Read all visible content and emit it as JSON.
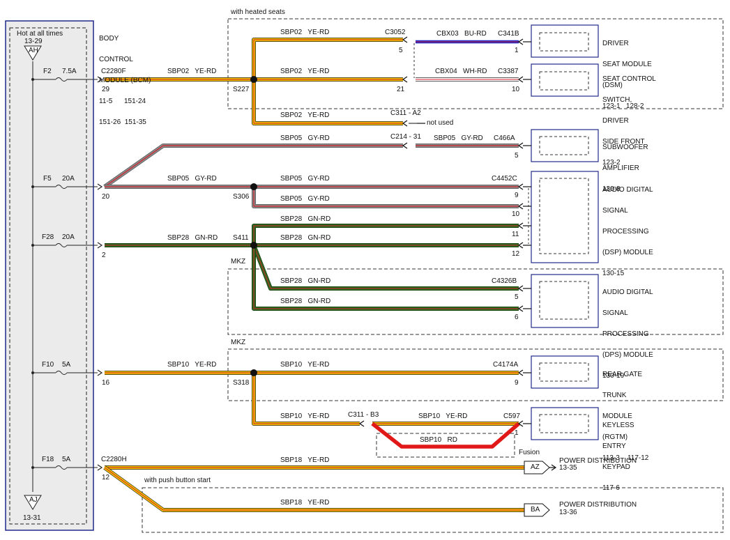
{
  "bcm": {
    "title_lines": [
      "BODY",
      "CONTROL",
      "MODULE (BCM)",
      "11-5      151-24",
      "151-26  151-35"
    ],
    "hot_at_all_times": "Hot at all times",
    "hot_ref": "13-29",
    "top_tag": "AH",
    "bottom_tag": "AJ",
    "bottom_ref": "13-31"
  },
  "fuses": [
    {
      "name": "F2",
      "rating": "7.5A",
      "pin": "29",
      "connector": "C2280F"
    },
    {
      "name": "F5",
      "rating": "20A",
      "pin": "20",
      "connector": ""
    },
    {
      "name": "F28",
      "rating": "20A",
      "pin": "2",
      "connector": ""
    },
    {
      "name": "F10",
      "rating": "5A",
      "pin": "16",
      "connector": ""
    },
    {
      "name": "F18",
      "rating": "5A",
      "pin": "12",
      "connector": "C2280H"
    }
  ],
  "options": {
    "heated_seats": "with heated seats",
    "mkz_1": "MKZ",
    "mkz_2": "MKZ",
    "push_button": "with push button start",
    "fusion": "Fusion",
    "not_used": "not used"
  },
  "splices": [
    "S227",
    "S306",
    "S411",
    "S318"
  ],
  "wires": {
    "sbp02": "SBP02   YE-RD",
    "sbp05": "SBP05   GY-RD",
    "sbp28": "SBP28   GN-RD",
    "sbp10": "SBP10   YE-RD",
    "sbp10_rd": "SBP10   RD",
    "sbp18": "SBP18   YE-RD",
    "cbx03": "CBX03   BU-RD",
    "cbx04": "CBX04   WH-RD"
  },
  "connectors": {
    "c3052": "C3052",
    "c341b": "C341B",
    "c3387": "C3387",
    "c311_a2": "C311 - A2",
    "c214_31": "C214 - 31",
    "c466a": "C466A",
    "c4452c": "C4452C",
    "c4326b": "C4326B",
    "c4174a": "C4174A",
    "c311_b3": "C311 - B3",
    "c597": "C597"
  },
  "pins": {
    "p5a": "5",
    "p1a": "1",
    "p21": "21",
    "p10a": "10",
    "p5b": "5",
    "p9a": "9",
    "p10b": "10",
    "p11": "11",
    "p12": "12",
    "p5c": "5",
    "p6": "6",
    "p9b": "9",
    "p1b": "1"
  },
  "modules": {
    "dsm": [
      "DRIVER",
      "SEAT MODULE",
      "(DSM)",
      "123-1   128-2"
    ],
    "seat_switch": [
      "SEAT CONTROL",
      "SWITCH,",
      "DRIVER",
      "SIDE FRONT",
      "123-2"
    ],
    "subwoofer": [
      "SUBWOOFER",
      "AMPLIFIER",
      "130-8"
    ],
    "dsp1": [
      "AUDIO DIGITAL",
      "SIGNAL",
      "PROCESSING",
      "(DSP) MODULE",
      "130-15"
    ],
    "dsp2": [
      "AUDIO DIGITAL",
      "SIGNAL",
      "PROCESSING",
      "(DPS) MODULE",
      "130-19"
    ],
    "rgtm": [
      "REAR GATE",
      "TRUNK",
      "MODULE",
      "(RGTM)",
      "113-3    117-12"
    ],
    "keypad": [
      "KEYLESS",
      "ENTRY",
      "KEYPAD",
      "117-6"
    ]
  },
  "power": [
    {
      "tag": "AZ",
      "label": "POWER DISTRIBUTION",
      "ref": "13-35"
    },
    {
      "tag": "BA",
      "label": "POWER DISTRIBUTION",
      "ref": "13-36"
    }
  ],
  "colors": {
    "ye_rd_main": "#f2c200",
    "gy_rd_main": "#8c8c8c",
    "gn_rd_main": "#2d6a1f",
    "bu_rd_main": "#1e28c8",
    "wh_rd_main": "#ffffff",
    "stripe_red": "#d0202a",
    "rd_main": "#e01818",
    "module_border": "#1f2a8a",
    "bcm_fill": "#ebebeb"
  }
}
